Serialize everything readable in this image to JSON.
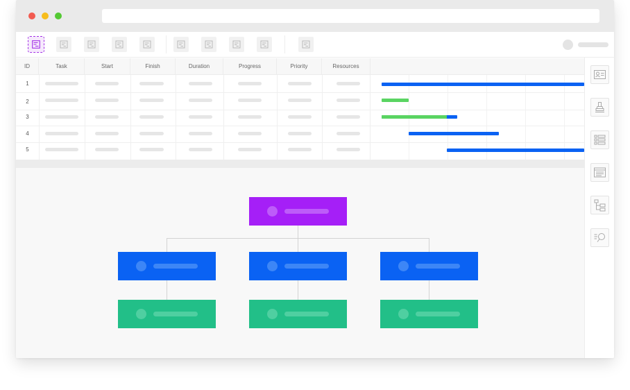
{
  "window": {
    "traffic_lights": [
      "close",
      "minimize",
      "zoom"
    ],
    "address_bar": ""
  },
  "toolbar": {
    "tools": [
      {
        "icon": "gantt-view-icon",
        "active": true
      },
      {
        "icon": "doc-icon"
      },
      {
        "icon": "doc-icon"
      },
      {
        "icon": "doc-icon"
      },
      {
        "icon": "doc-icon"
      },
      {
        "icon": "doc-icon"
      },
      {
        "icon": "doc-icon"
      },
      {
        "icon": "doc-icon"
      },
      {
        "icon": "doc-icon"
      },
      {
        "icon": "doc-icon"
      }
    ],
    "accent_color": "#a12ee6"
  },
  "table": {
    "columns": [
      "ID",
      "Task",
      "Start",
      "Finish",
      "Duration",
      "Progress",
      "Priority",
      "Resources"
    ],
    "rows": [
      {
        "id": "1"
      },
      {
        "id": "2"
      },
      {
        "id": "3"
      },
      {
        "id": "4"
      },
      {
        "id": "5"
      }
    ]
  },
  "gantt": {
    "colors": {
      "planned": "#0a62f3",
      "progress": "#5ad462"
    },
    "rows": [
      {
        "id": "1",
        "progress": 0
      },
      {
        "id": "2",
        "progress": 1
      },
      {
        "id": "3",
        "progress": 0.86
      },
      {
        "id": "4",
        "progress": 0
      },
      {
        "id": "5",
        "progress": 0
      }
    ]
  },
  "diagram": {
    "colors": {
      "root": "#a51ff7",
      "level2": "#0a62f3",
      "level3": "#22bf88"
    },
    "root": {
      "label": ""
    },
    "children": [
      {
        "label": "",
        "children": [
          {
            "label": ""
          }
        ]
      },
      {
        "label": "",
        "children": [
          {
            "label": ""
          }
        ]
      },
      {
        "label": "",
        "children": [
          {
            "label": ""
          }
        ]
      }
    ]
  },
  "side_panel": {
    "buttons": [
      "contact-card-icon",
      "stamp-icon",
      "list-icon",
      "form-window-icon",
      "tree-icon",
      "search-list-icon"
    ]
  }
}
